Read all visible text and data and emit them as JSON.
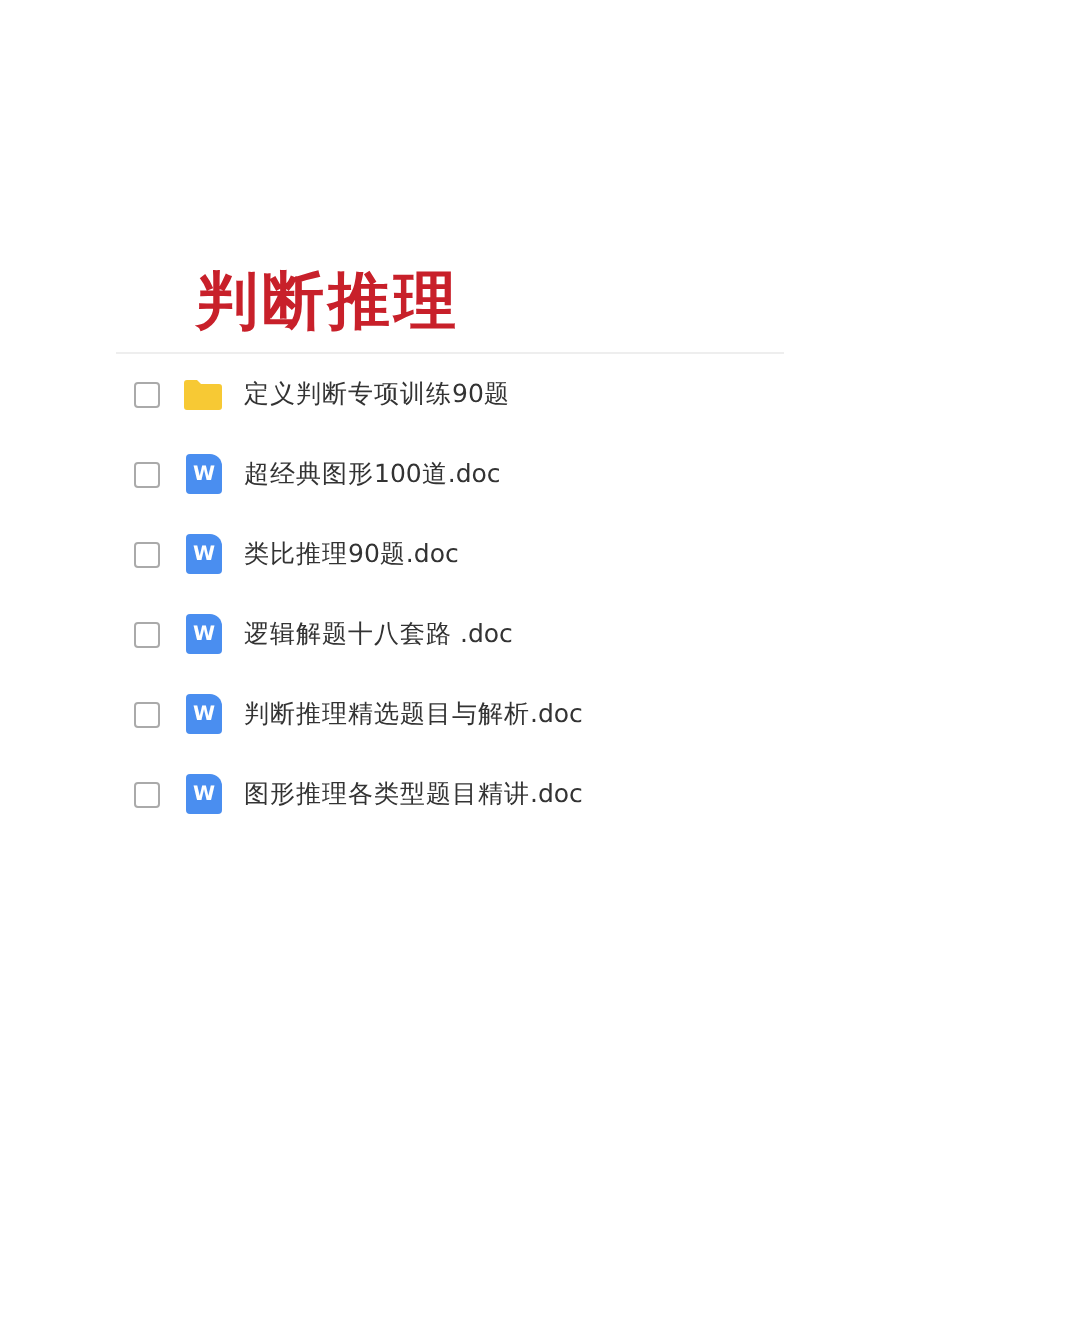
{
  "title": "判断推理",
  "files": [
    {
      "kind": "folder",
      "name": "定义判断专项训练90题",
      "checked": false
    },
    {
      "kind": "doc",
      "icon_text": "W",
      "name": "超经典图形100道.doc",
      "checked": false
    },
    {
      "kind": "doc",
      "icon_text": "W",
      "name": "类比推理90题.doc",
      "checked": false
    },
    {
      "kind": "doc",
      "icon_text": "W",
      "name": "逻辑解题十八套路 .doc",
      "checked": false
    },
    {
      "kind": "doc",
      "icon_text": "W",
      "name": "判断推理精选题目与解析.doc",
      "checked": false
    },
    {
      "kind": "doc",
      "icon_text": "W",
      "name": "图形推理各类型题目精讲.doc",
      "checked": false
    }
  ]
}
